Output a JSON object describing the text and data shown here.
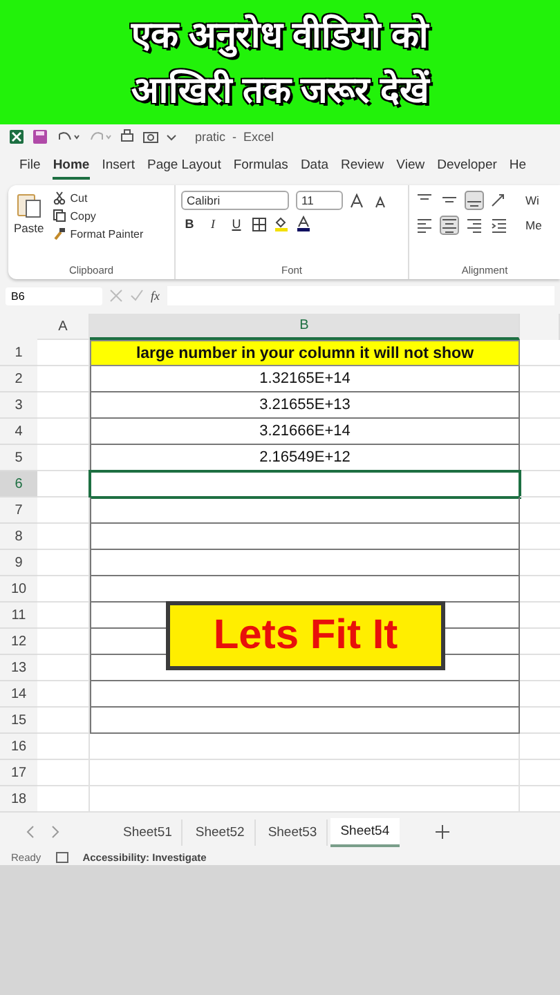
{
  "banner": {
    "lines": [
      "एक अनुरोध वीडियो को",
      "आखिरी तक जरूर देखें"
    ]
  },
  "title_bar": {
    "title": "pratic  -  Excel"
  },
  "menu": [
    {
      "label": "File",
      "selected": false
    },
    {
      "label": "Home",
      "selected": true
    },
    {
      "label": "Insert",
      "selected": false
    },
    {
      "label": "Page Layout",
      "selected": false
    },
    {
      "label": "Formulas",
      "selected": false
    },
    {
      "label": "Data",
      "selected": false
    },
    {
      "label": "Review",
      "selected": false
    },
    {
      "label": "View",
      "selected": false
    },
    {
      "label": "Developer",
      "selected": false
    },
    {
      "label": "He",
      "selected": false
    }
  ],
  "ribbon": {
    "clipboard": {
      "paste": "Paste",
      "cut": "Cut",
      "copy": "Copy",
      "format_painter": "Format Painter",
      "label": "Clipboard"
    },
    "font": {
      "name": "Calibri",
      "size": "11",
      "bold": "B",
      "italic": "I",
      "underline": "U",
      "label": "Font"
    },
    "alignment": {
      "top_row": [
        {
          "kind": "top",
          "selected": false
        },
        {
          "kind": "middle",
          "selected": false
        },
        {
          "kind": "bottom",
          "selected": true
        }
      ],
      "bottom_row": [
        {
          "kind": "left",
          "selected": false
        },
        {
          "kind": "center",
          "selected": true
        },
        {
          "kind": "right",
          "selected": false
        }
      ],
      "wrap": "Wi",
      "merge": "Me",
      "label": "Alignment"
    }
  },
  "formula_bar": {
    "name_box": "B6",
    "fx": "fx"
  },
  "columns": [
    "A",
    "B"
  ],
  "rows": [
    {
      "number": "1",
      "value": "large number in your column it will not show",
      "kind": "header",
      "selected": false
    },
    {
      "number": "2",
      "value": "1.32165E+14",
      "kind": "data",
      "selected": false
    },
    {
      "number": "3",
      "value": "3.21655E+13",
      "kind": "data",
      "selected": false
    },
    {
      "number": "4",
      "value": "3.21666E+14",
      "kind": "data",
      "selected": false
    },
    {
      "number": "5",
      "value": "2.16549E+12",
      "kind": "data",
      "selected": false
    },
    {
      "number": "6",
      "kind": "data",
      "selected": true
    },
    {
      "number": "7",
      "kind": "data",
      "selected": false
    },
    {
      "number": "8",
      "kind": "data",
      "selected": false
    },
    {
      "number": "9",
      "kind": "data",
      "selected": false
    },
    {
      "number": "10",
      "kind": "data",
      "selected": false
    },
    {
      "number": "11",
      "kind": "data",
      "selected": false
    },
    {
      "number": "12",
      "kind": "data",
      "selected": false
    },
    {
      "number": "13",
      "kind": "data",
      "selected": false
    },
    {
      "number": "14",
      "kind": "data",
      "selected": false
    },
    {
      "number": "15",
      "kind": "data",
      "selected": false
    },
    {
      "number": "16",
      "kind": "empty",
      "selected": false
    },
    {
      "number": "17",
      "kind": "empty",
      "selected": false
    },
    {
      "number": "18",
      "kind": "empty",
      "selected": false
    }
  ],
  "overlay": {
    "text": "Lets Fit It"
  },
  "sheets": [
    {
      "label": "Sheet51",
      "selected": false
    },
    {
      "label": "Sheet52",
      "selected": false
    },
    {
      "label": "Sheet53",
      "selected": false
    },
    {
      "label": "Sheet54",
      "selected": true
    }
  ],
  "status_bar": {
    "ready": "Ready",
    "accessibility": "Accessibility: Investigate"
  }
}
